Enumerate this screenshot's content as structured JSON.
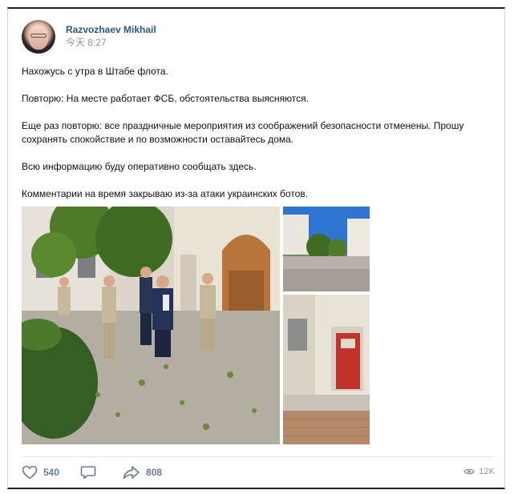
{
  "post": {
    "author": "Razvozhaev Mikhail",
    "time": "今天 8:27",
    "paragraphs": [
      "Нахожусь с утра в Штабе флота.",
      "Повторю: На месте работает ФСБ, обстоятельства выясняются.",
      "Еще раз повторю: все праздничные мероприятия из соображений безопасности отменены. Прошу сохранять спокойствие и по возможности оставайтесь дома.",
      "Всю информацию буду оперативно сообщать здесь.",
      "Комментарии на время закрываю из-за атаки украинских ботов."
    ]
  },
  "actions": {
    "likes": "540",
    "comments": "",
    "shares": "808",
    "views": "12K"
  },
  "icons": {
    "like": "heart-icon",
    "comment": "comment-icon",
    "share": "share-arrow-icon",
    "views": "eye-icon"
  },
  "colors": {
    "author_link": "#2a5885",
    "action_text": "#6a7b8f",
    "muted": "#939393"
  }
}
